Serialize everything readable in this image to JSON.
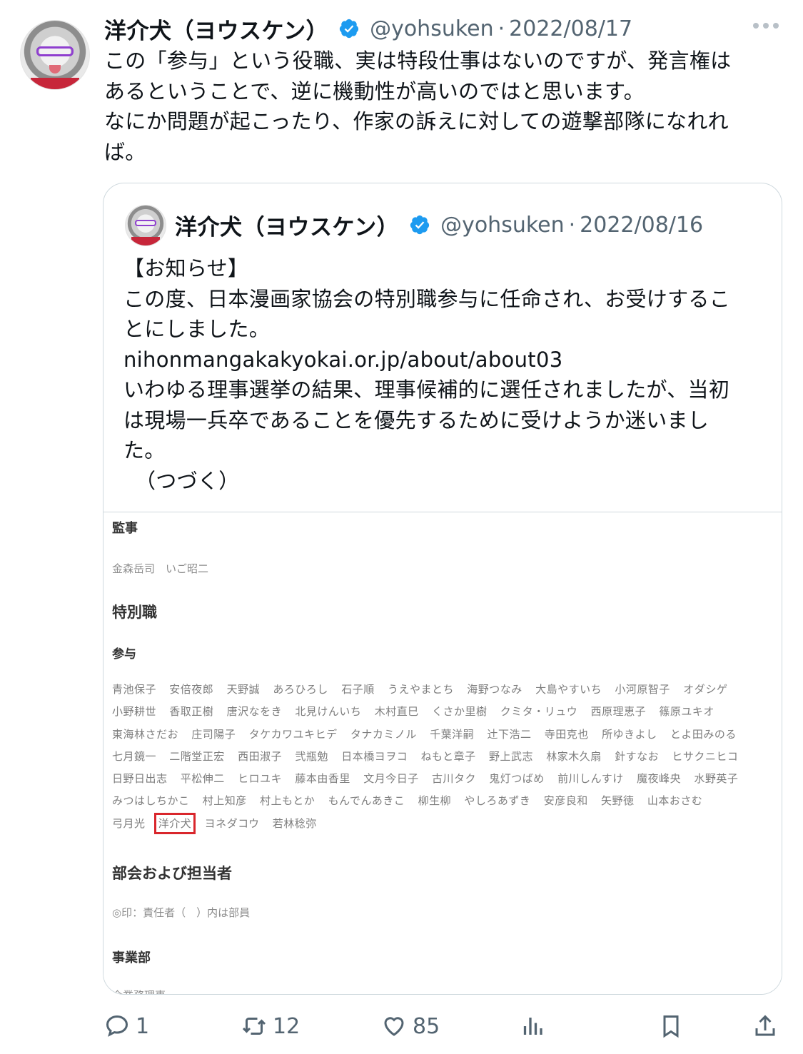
{
  "tweet": {
    "author_name": "洋介犬（ヨウスケン）",
    "handle": "@yohsuken",
    "dot": "·",
    "date": "2022/08/17",
    "text_lines": [
      "この「参与」という役職、実は特段仕事はないのですが、発言権は",
      "あるということで、逆に機動性が高いのではと思います。",
      "なにか問題が起こったり、作家の訴えに対しての遊撃部隊になれれ",
      "ば。"
    ]
  },
  "quoted_tweet": {
    "author_name": "洋介犬（ヨウスケン）",
    "handle": "@yohsuken",
    "dot": "·",
    "date": "2022/08/16",
    "text_lines": [
      "【お知らせ】",
      "この度、日本漫画家協会の特別職参与に任命され、お受けするこ",
      "とにしました。",
      "nihonmangakakyokai.or.jp/about/about03",
      "いわゆる理事選挙の結果、理事候補的に選任されましたが、当初",
      "は現場一兵卒であることを優先するために受けようか迷いまし",
      "た。",
      "（つづく）"
    ],
    "image": {
      "heading_kanji": "監事",
      "kanji_names": "金森岳司　いご昭二",
      "heading_special": "特別職",
      "heading_sanyo": "参与",
      "sanyo_names": [
        "青池保子",
        "安倍夜郎",
        "天野誠",
        "あろひろし",
        "石子順",
        "うえやまとち",
        "海野つなみ",
        "大島やすいち",
        "小河原智子",
        "オダシゲ",
        "小野耕世",
        "香取正樹",
        "唐沢なをき",
        "北見けんいち",
        "木村直巳",
        "くさか里樹",
        "クミタ・リュウ",
        "西原理恵子",
        "篠原ユキオ",
        "東海林さだお",
        "庄司陽子",
        "タケカワユキヒデ",
        "タナカミノル",
        "千葉洋嗣",
        "辻下浩二",
        "寺田克也",
        "所ゆきよし",
        "とよ田みのる",
        "七月鏡一",
        "二階堂正宏",
        "西田淑子",
        "弐瓶勉",
        "日本橋ヨヲコ",
        "ねもと章子",
        "野上武志",
        "林家木久扇",
        "針すなお",
        "ヒサクニヒコ",
        "日野日出志",
        "平松伸二",
        "ヒロユキ",
        "藤本由香里",
        "文月今日子",
        "古川タク",
        "鬼灯つばめ",
        "前川しんすけ",
        "魔夜峰央",
        "水野英子",
        "みつはしちかこ",
        "村上知彦",
        "村上もとか",
        "もんでんあきこ",
        "柳生柳",
        "やしろあずき",
        "安彦良和",
        "矢野徳",
        "山本おさむ",
        "弓月光",
        "洋介犬",
        "ヨネダコウ",
        "若林稔弥"
      ],
      "highlighted_name": "洋介犬",
      "heading_bukai": "部会および担当者",
      "bukai_note": "◎印：責任者（　）内は部員",
      "heading_jigyo": "事業部",
      "cutoff_text": "企業務理事"
    }
  },
  "actions": {
    "reply_count": "1",
    "retweet_count": "12",
    "like_count": "85"
  },
  "colors": {
    "verified": "#1d9bf0",
    "secondary_text": "#536471",
    "highlight_box": "#d9262c"
  },
  "icons": [
    "verified-badge-icon",
    "more-icon",
    "reply-icon",
    "retweet-icon",
    "like-icon",
    "views-icon",
    "bookmark-icon",
    "share-icon"
  ]
}
